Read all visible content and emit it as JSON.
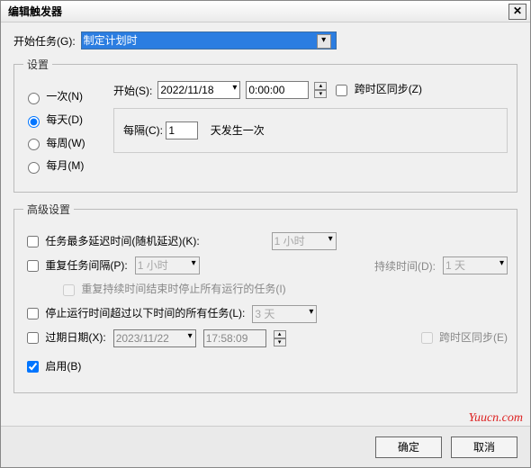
{
  "title": "编辑触发器",
  "close": "✕",
  "taskLabel": "开始任务(G):",
  "taskValue": "制定计划时",
  "settings": {
    "legend": "设置",
    "radios": {
      "once": "一次(N)",
      "daily": "每天(D)",
      "weekly": "每周(W)",
      "monthly": "每月(M)"
    },
    "startLabel": "开始(S):",
    "startDate": "2022/11/18",
    "startTime": "0:00:00",
    "tzSync": "跨时区同步(Z)",
    "recurLabel": "每隔(C):",
    "recurValue": "1",
    "recurSuffix": "天发生一次"
  },
  "adv": {
    "legend": "高级设置",
    "delayLabel": "任务最多延迟时间(随机延迟)(K):",
    "delayValue": "1 小时",
    "repeatLabel": "重复任务间隔(P):",
    "repeatValue": "1 小时",
    "durationLabel": "持续时间(D):",
    "durationValue": "1 天",
    "stopAtEnd": "重复持续时间结束时停止所有运行的任务(I)",
    "stopLongLabel": "停止运行时间超过以下时间的所有任务(L):",
    "stopLongValue": "3 天",
    "expireLabel": "过期日期(X):",
    "expireDate": "2023/11/22",
    "expireTime": "17:58:09",
    "expireTz": "跨时区同步(E)",
    "enabled": "启用(B)"
  },
  "buttons": {
    "ok": "确定",
    "cancel": "取消"
  },
  "watermark": "Yuucn.com"
}
